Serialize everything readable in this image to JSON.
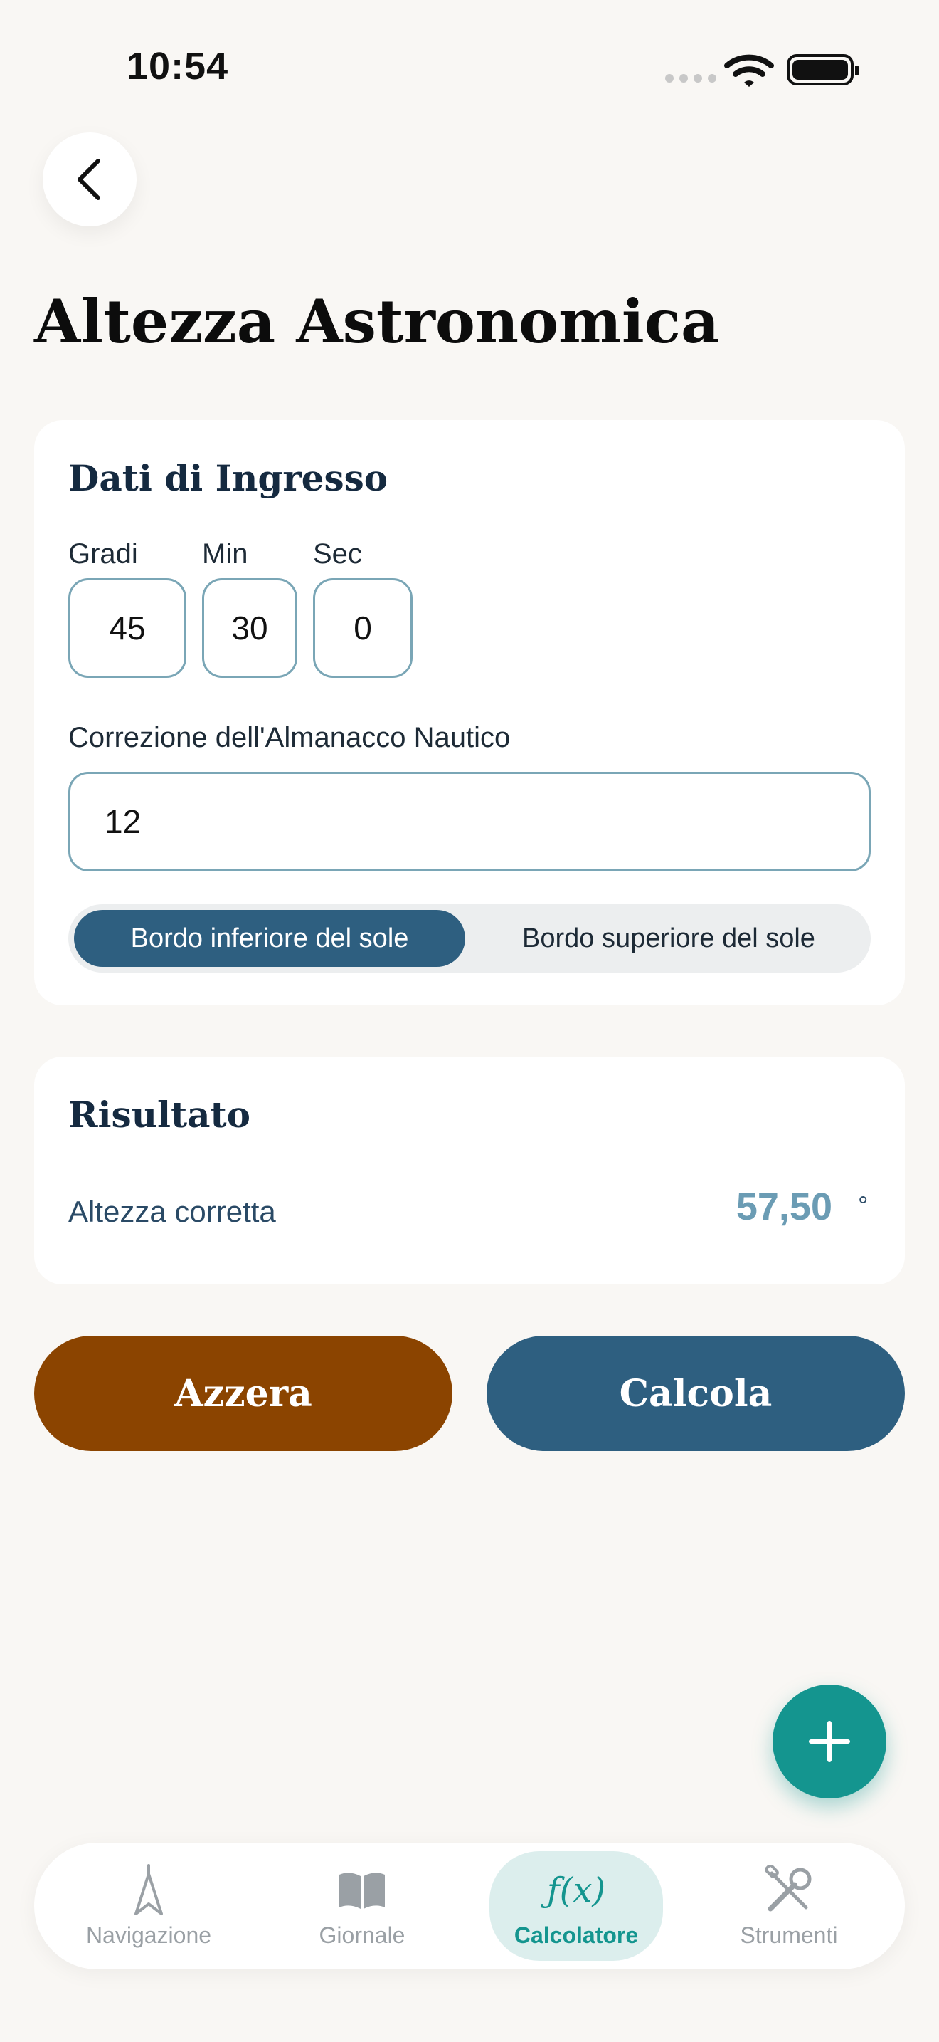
{
  "status_bar": {
    "time": "10:54"
  },
  "page": {
    "title": "Altezza Astronomica"
  },
  "input": {
    "section_title": "Dati di Ingresso",
    "degrees": {
      "label": "Gradi",
      "value": "45"
    },
    "minutes": {
      "label": "Min",
      "value": "30"
    },
    "seconds": {
      "label": "Sec",
      "value": "0"
    },
    "correction": {
      "label": "Correzione dell'Almanacco Nautico",
      "value": "12"
    },
    "limb": {
      "options": [
        "Bordo inferiore del sole",
        "Bordo superiore del sole"
      ],
      "selected": "Bordo inferiore del sole"
    }
  },
  "result": {
    "section_title": "Risultato",
    "label": "Altezza corretta",
    "value": "57,50",
    "unit": "°"
  },
  "actions": {
    "reset_label": "Azzera",
    "calculate_label": "Calcola"
  },
  "tabbar": {
    "items": [
      {
        "label": "Navigazione",
        "icon": "navigation-icon"
      },
      {
        "label": "Giornale",
        "icon": "book-icon"
      },
      {
        "label": "Calcolatore",
        "icon": "function-icon",
        "glyph": "ƒ(x)"
      },
      {
        "label": "Strumenti",
        "icon": "tools-icon"
      }
    ],
    "active": "Calcolatore"
  },
  "colors": {
    "primary": "#2e5f80",
    "reset": "#8b4400",
    "accent": "#14958f",
    "result_value": "#6b9cb4",
    "background": "#f9f7f4"
  }
}
